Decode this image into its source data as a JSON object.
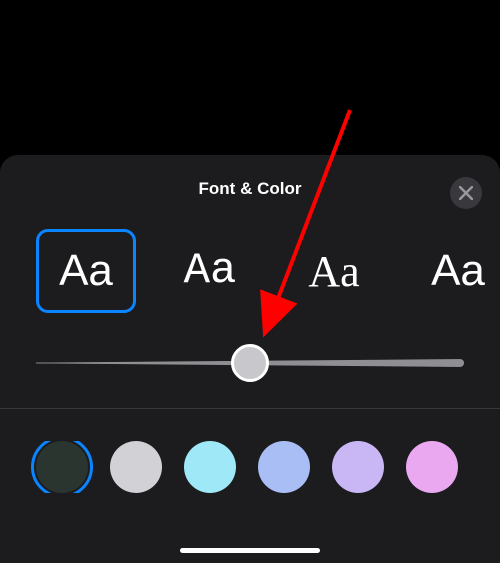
{
  "sheet": {
    "title": "Font & Color",
    "close_label": "Close"
  },
  "fonts": {
    "sample": "Aa",
    "options": [
      {
        "name": "sans",
        "selected": true
      },
      {
        "name": "slab",
        "selected": false
      },
      {
        "name": "serif",
        "selected": false
      },
      {
        "name": "condensed",
        "selected": false
      }
    ]
  },
  "slider": {
    "value": 50,
    "min": 0,
    "max": 100
  },
  "colors": {
    "options": [
      {
        "name": "dark-green",
        "hex": "#2a3530",
        "selected": true
      },
      {
        "name": "light-gray",
        "hex": "#d1d1d6",
        "selected": false
      },
      {
        "name": "cyan",
        "hex": "#9ee8f7",
        "selected": false
      },
      {
        "name": "periwinkle",
        "hex": "#a9bef5",
        "selected": false
      },
      {
        "name": "lavender",
        "hex": "#c9b6f5",
        "selected": false
      },
      {
        "name": "pink",
        "hex": "#e9a8f0",
        "selected": false
      }
    ]
  },
  "annotation": {
    "arrow_color": "#ff0000"
  }
}
